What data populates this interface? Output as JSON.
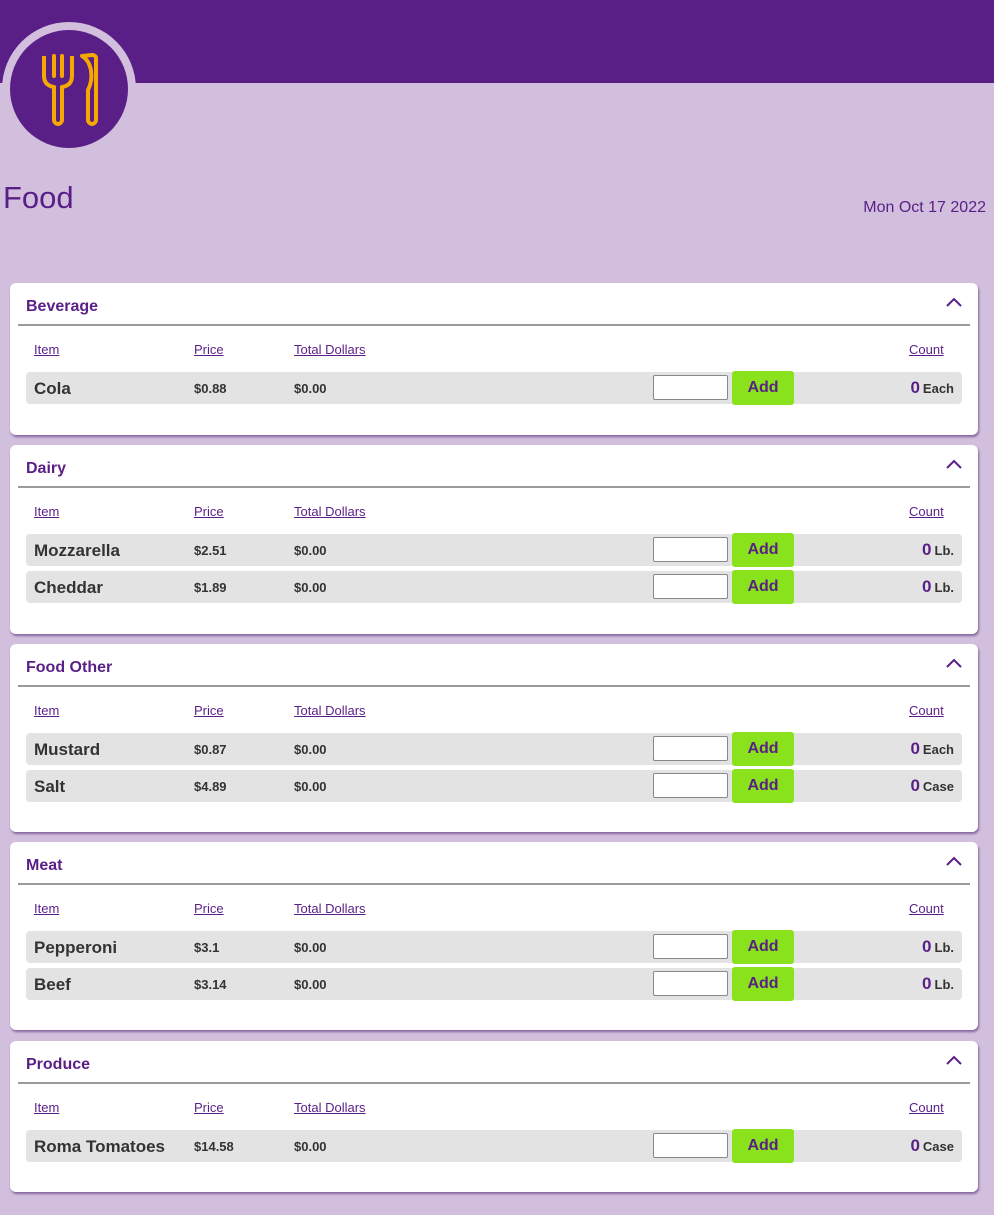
{
  "header": {
    "title": "Food",
    "date": "Mon Oct 17 2022",
    "logo_icon": "fork-knife-icon"
  },
  "columns": {
    "item": "Item",
    "price": "Price",
    "total": "Total Dollars",
    "count": "Count"
  },
  "add_label": "Add",
  "colors": {
    "brand_purple": "#5a1f87",
    "page_bg": "#d2bedd",
    "add_green": "#89e21c",
    "icon_orange": "#f5a800"
  },
  "categories": [
    {
      "name": "Beverage",
      "items": [
        {
          "name": "Cola",
          "price": "$0.88",
          "total": "$0.00",
          "count": "0",
          "unit": "Each",
          "input": ""
        }
      ]
    },
    {
      "name": "Dairy",
      "items": [
        {
          "name": "Mozzarella",
          "price": "$2.51",
          "total": "$0.00",
          "count": "0",
          "unit": "Lb.",
          "input": ""
        },
        {
          "name": "Cheddar",
          "price": "$1.89",
          "total": "$0.00",
          "count": "0",
          "unit": "Lb.",
          "input": ""
        }
      ]
    },
    {
      "name": "Food Other",
      "items": [
        {
          "name": "Mustard",
          "price": "$0.87",
          "total": "$0.00",
          "count": "0",
          "unit": "Each",
          "input": ""
        },
        {
          "name": "Salt",
          "price": "$4.89",
          "total": "$0.00",
          "count": "0",
          "unit": "Case",
          "input": ""
        }
      ]
    },
    {
      "name": "Meat",
      "items": [
        {
          "name": "Pepperoni",
          "price": "$3.1",
          "total": "$0.00",
          "count": "0",
          "unit": "Lb.",
          "input": ""
        },
        {
          "name": "Beef",
          "price": "$3.14",
          "total": "$0.00",
          "count": "0",
          "unit": "Lb.",
          "input": ""
        }
      ]
    },
    {
      "name": "Produce",
      "items": [
        {
          "name": "Roma Tomatoes",
          "price": "$14.58",
          "total": "$0.00",
          "count": "0",
          "unit": "Case",
          "input": ""
        }
      ]
    }
  ]
}
